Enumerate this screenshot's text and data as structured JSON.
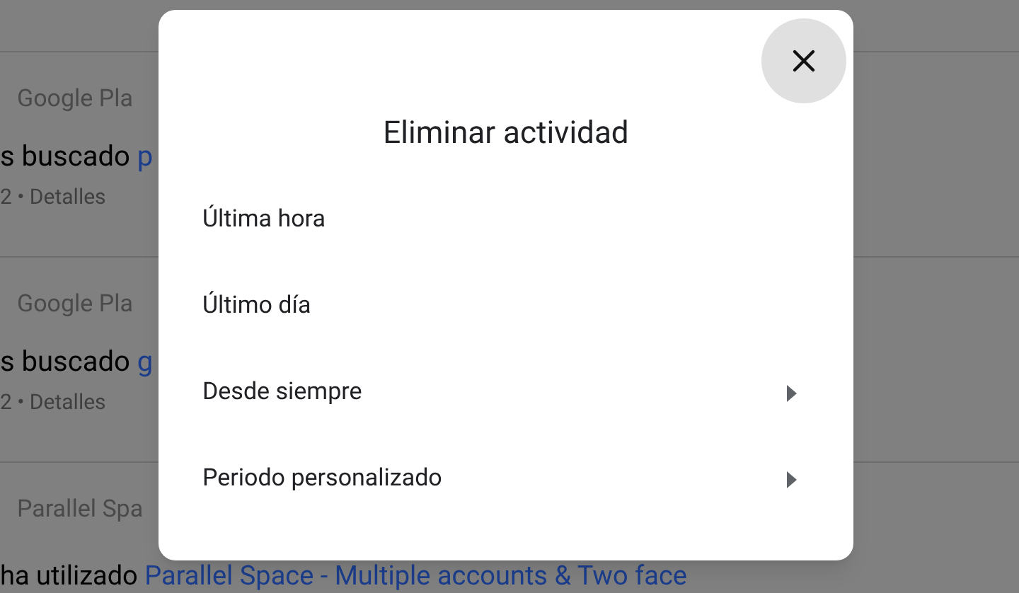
{
  "activity_list": [
    {
      "app": "Google Pla",
      "text": "s buscado ",
      "link": "p",
      "details": "2 • Detalles"
    },
    {
      "app": "Google Pla",
      "text": "s buscado ",
      "link": "g",
      "details": "2 • Detalles"
    },
    {
      "app": "Parallel Spa",
      "text": "ha utilizado ",
      "link": "Parallel Space - Multiple accounts & Two face"
    }
  ],
  "dialog": {
    "title": "Eliminar actividad",
    "options": [
      {
        "label": "Última hora",
        "kind": "action"
      },
      {
        "label": "Último día",
        "kind": "action"
      },
      {
        "label": "Desde siempre",
        "kind": "submenu"
      },
      {
        "label": "Periodo personalizado",
        "kind": "submenu"
      }
    ]
  }
}
